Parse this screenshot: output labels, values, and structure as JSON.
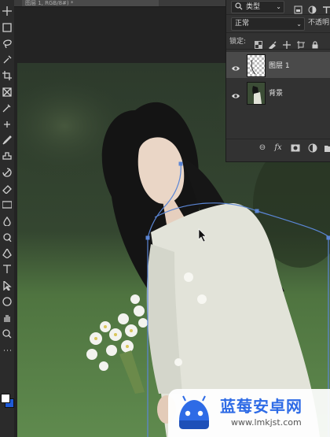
{
  "document": {
    "tab_title": "图层 1, RGB/8#) *"
  },
  "toolbar": {
    "tools": [
      {
        "name": "move-tool-icon"
      },
      {
        "name": "marquee-tool-icon"
      },
      {
        "name": "lasso-tool-icon"
      },
      {
        "name": "quick-select-tool-icon"
      },
      {
        "name": "crop-tool-icon"
      },
      {
        "name": "frame-tool-icon"
      },
      {
        "name": "eyedropper-tool-icon"
      },
      {
        "name": "healing-brush-tool-icon"
      },
      {
        "name": "brush-tool-icon"
      },
      {
        "name": "clone-stamp-tool-icon"
      },
      {
        "name": "history-brush-tool-icon"
      },
      {
        "name": "eraser-tool-icon"
      },
      {
        "name": "gradient-tool-icon"
      },
      {
        "name": "blur-tool-icon"
      },
      {
        "name": "dodge-tool-icon"
      },
      {
        "name": "pen-tool-icon"
      },
      {
        "name": "type-tool-icon"
      },
      {
        "name": "path-select-tool-icon"
      },
      {
        "name": "shape-tool-icon"
      },
      {
        "name": "hand-tool-icon"
      },
      {
        "name": "zoom-tool-icon"
      },
      {
        "name": "more-tools-icon"
      }
    ],
    "foreground_color": "#ffffff",
    "background_color": "#1f5bd6"
  },
  "layers_panel": {
    "filter_label": "类型",
    "blend_mode": "正常",
    "opacity_label": "不透明",
    "lock_label": "锁定:",
    "layers": [
      {
        "name": "图层 1",
        "visible": true,
        "selected": true
      },
      {
        "name": "背景",
        "visible": true,
        "selected": false
      }
    ]
  },
  "watermark": {
    "title": "蓝莓安卓网",
    "url": "www.lmkjst.com"
  }
}
